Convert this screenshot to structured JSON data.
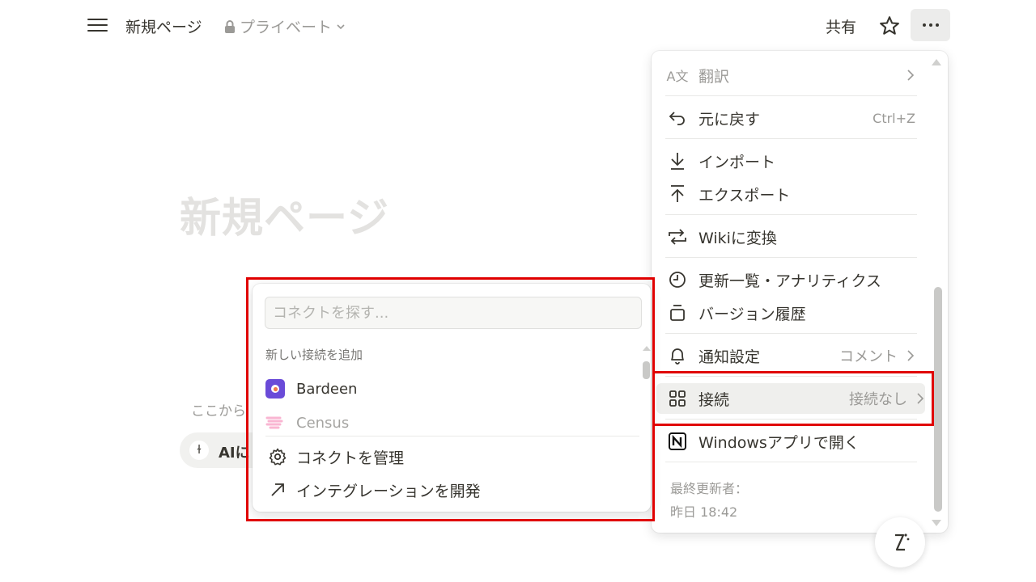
{
  "topbar": {
    "title": "新規ページ",
    "privacy": "プライベート",
    "share": "共有"
  },
  "page": {
    "heading": "新規ページ",
    "hint": "ここから",
    "ai_label": "AIに"
  },
  "menu": {
    "translate": "翻訳",
    "undo": "元に戻す",
    "undo_shortcut": "Ctrl+Z",
    "import": "インポート",
    "export": "エクスポート",
    "wiki": "Wikiに変換",
    "updates": "更新一覧・アナリティクス",
    "history": "バージョン履歴",
    "notify": "通知設定",
    "notify_value": "コメント",
    "connect": "接続",
    "connect_value": "接続なし",
    "open_app": "Windowsアプリで開く",
    "last_edited_label": "最終更新者：",
    "last_edited_time": "昨日 18:42"
  },
  "connect_popup": {
    "search_placeholder": "コネクトを探す...",
    "section": "新しい接続を追加",
    "apps": [
      {
        "name": "Bardeen"
      },
      {
        "name": "Census"
      }
    ],
    "manage": "コネクトを管理",
    "develop": "インテグレーションを開発"
  },
  "colors": {
    "highlight_red": "#e00000",
    "text": "#37352f",
    "muted": "#9b9a97",
    "bardeen": "#6a4bd8",
    "census": "#f25c9c"
  }
}
